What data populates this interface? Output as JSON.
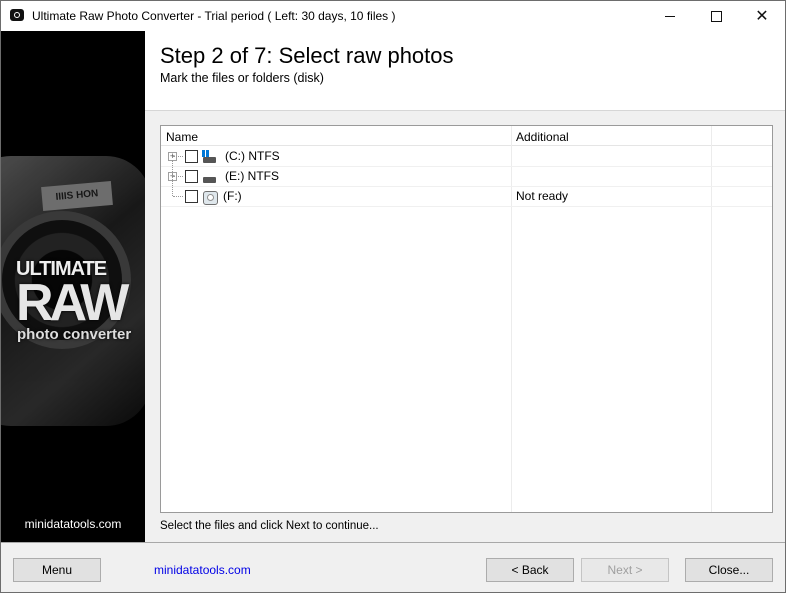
{
  "window": {
    "title": "Ultimate Raw Photo Converter - Trial period ( Left: 30 days, 10 files )",
    "controls": {
      "minimize": "",
      "maximize": "",
      "close": "✕"
    }
  },
  "sidebar": {
    "logo_ultimate": "ULTIMATE",
    "logo_raw": "RAW",
    "logo_photo": "photo converter",
    "camera_plate": "IIIIS HON",
    "url": "minidatatools.com"
  },
  "page": {
    "title": "Step 2 of 7: Select raw photos",
    "subtitle": "Mark the files or folders (disk)",
    "hint": "Select the files and click Next to continue..."
  },
  "tree": {
    "columns": [
      "Name",
      "Additional"
    ],
    "rows": [
      {
        "expander": "+",
        "name": "(C:) NTFS",
        "additional": "",
        "icon": "windows-drive-icon"
      },
      {
        "expander": "+",
        "name": "(E:) NTFS",
        "additional": "",
        "icon": "drive-icon"
      },
      {
        "expander": "",
        "name": "(F:)",
        "additional": "Not ready",
        "icon": "cd-drive-icon"
      }
    ]
  },
  "footer": {
    "menu": "Menu",
    "link": "minidatatools.com",
    "back": "< Back",
    "next": "Next >",
    "close": "Close..."
  },
  "colors": {
    "accent_link": "#0000e6",
    "disabled_text": "#9f9f9f",
    "sidebar_background": "#000000"
  }
}
